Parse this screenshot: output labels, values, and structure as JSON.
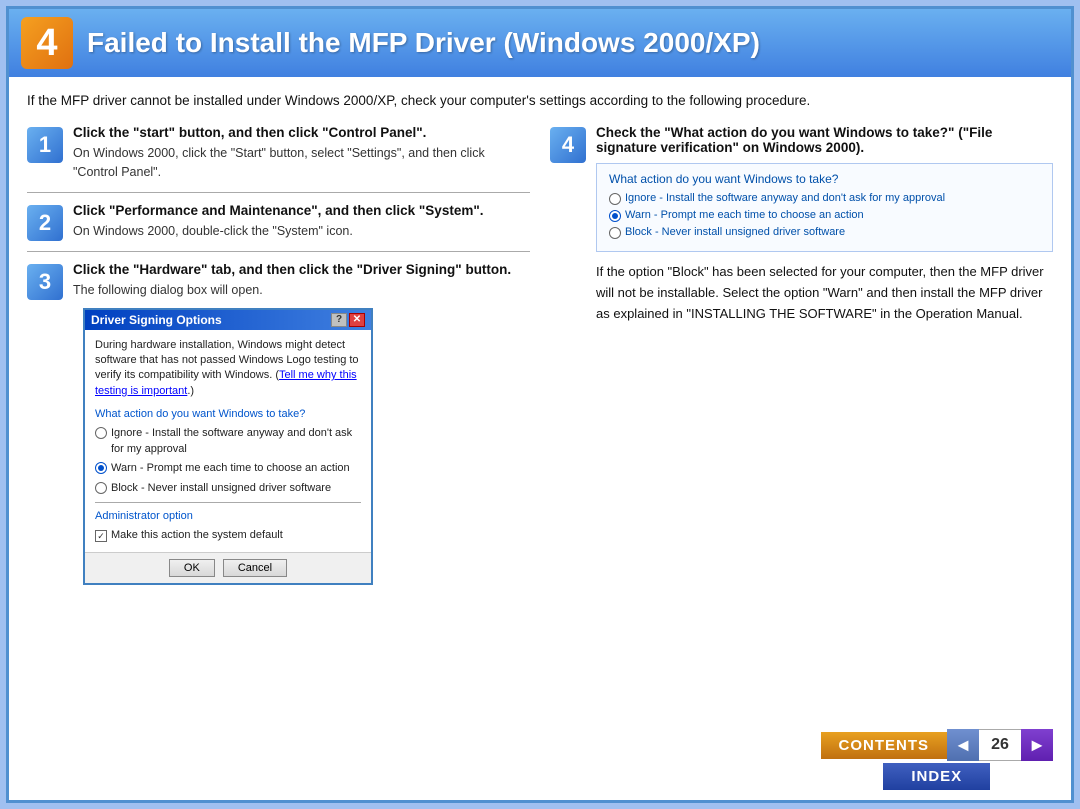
{
  "header": {
    "step_number": "4",
    "title": "Failed to Install the MFP Driver (Windows 2000/XP)"
  },
  "intro": {
    "text": "If the MFP driver cannot be installed under Windows 2000/XP, check your computer's settings according to the following procedure."
  },
  "left_column": {
    "steps": [
      {
        "number": "1",
        "title": "Click the \"start\" button, and then click \"Control Panel\".",
        "description": "On Windows 2000, click the \"Start\" button, select \"Settings\", and then click \"Control Panel\"."
      },
      {
        "number": "2",
        "title": "Click \"Performance and Maintenance\", and then click \"System\".",
        "description": "On Windows 2000, double-click the \"System\" icon."
      },
      {
        "number": "3",
        "title": "Click the \"Hardware\" tab, and then click the \"Driver Signing\" button.",
        "description": "The following dialog box will open."
      }
    ],
    "dialog": {
      "title": "Driver Signing Options",
      "body_text": "During hardware installation, Windows might detect software that has not passed Windows Logo testing to verify its compatibility with Windows. (",
      "link_text": "Tell me why this testing is important",
      "body_text2": ".)",
      "section_title": "What action do you want Windows to take?",
      "radio_options": [
        {
          "label": "Ignore - Install the software anyway and don't ask for my approval",
          "selected": false
        },
        {
          "label": "Warn - Prompt me each time to choose an action",
          "selected": true
        },
        {
          "label": "Block - Never install unsigned driver software",
          "selected": false
        }
      ],
      "admin_section_title": "Administrator option",
      "checkbox_label": "Make this action the system default",
      "checkbox_checked": true,
      "ok_label": "OK",
      "cancel_label": "Cancel"
    }
  },
  "right_column": {
    "step": {
      "number": "4",
      "title": "Check the \"What action do you want Windows to take?\" (\"File signature verification\" on Windows 2000).",
      "action_box": {
        "title": "What action do you want Windows to take?",
        "radio_options": [
          {
            "label": "Ignore - Install the software anyway and don't ask for my approval",
            "selected": false
          },
          {
            "label": "Warn - Prompt me each time to choose an action",
            "selected": true
          },
          {
            "label": "Block - Never install unsigned driver software",
            "selected": false
          }
        ]
      },
      "result_text": "If the option \"Block\" has been selected for your computer, then the MFP driver will not be installable. Select the option \"Warn\" and then install the MFP driver as explained in \"INSTALLING THE SOFTWARE\" in the Operation Manual."
    }
  },
  "navigation": {
    "contents_label": "CONTENTS",
    "index_label": "INDEX",
    "page_number": "26",
    "prev_arrow": "◄",
    "next_arrow": "►"
  }
}
